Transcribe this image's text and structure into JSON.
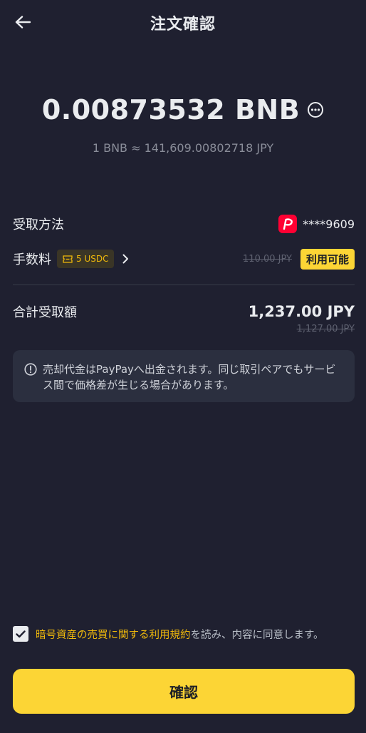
{
  "header": {
    "title": "注文確認"
  },
  "order": {
    "amount": "0.00873532 BNB",
    "rate": "1 BNB ≈ 141,609.00802718 JPY"
  },
  "receive": {
    "label": "受取方法",
    "account": "****9609"
  },
  "fee": {
    "label": "手数料",
    "coupon": "5 USDC",
    "original": "110.00 JPY",
    "badge": "利用可能"
  },
  "total": {
    "label": "合計受取額",
    "amount": "1,237.00 JPY",
    "original": "1,127.00 JPY"
  },
  "notice": {
    "text": "売却代金はPayPayへ出金されます。同じ取引ペアでもサービス間で価格差が生じる場合があります。"
  },
  "terms": {
    "link": "暗号資産の売買に関する利用規約",
    "suffix": "を読み、内容に同意します。",
    "checked": true
  },
  "confirm_label": "確認",
  "colors": {
    "background": "#1f2030",
    "accent": "#fcd535",
    "link": "#f0b90b",
    "paypay": "#ff0033"
  },
  "icons": [
    "back-arrow-icon",
    "more-icon",
    "paypay-logo-icon",
    "ticket-icon",
    "chevron-right-icon",
    "info-icon",
    "checkmark-icon"
  ]
}
